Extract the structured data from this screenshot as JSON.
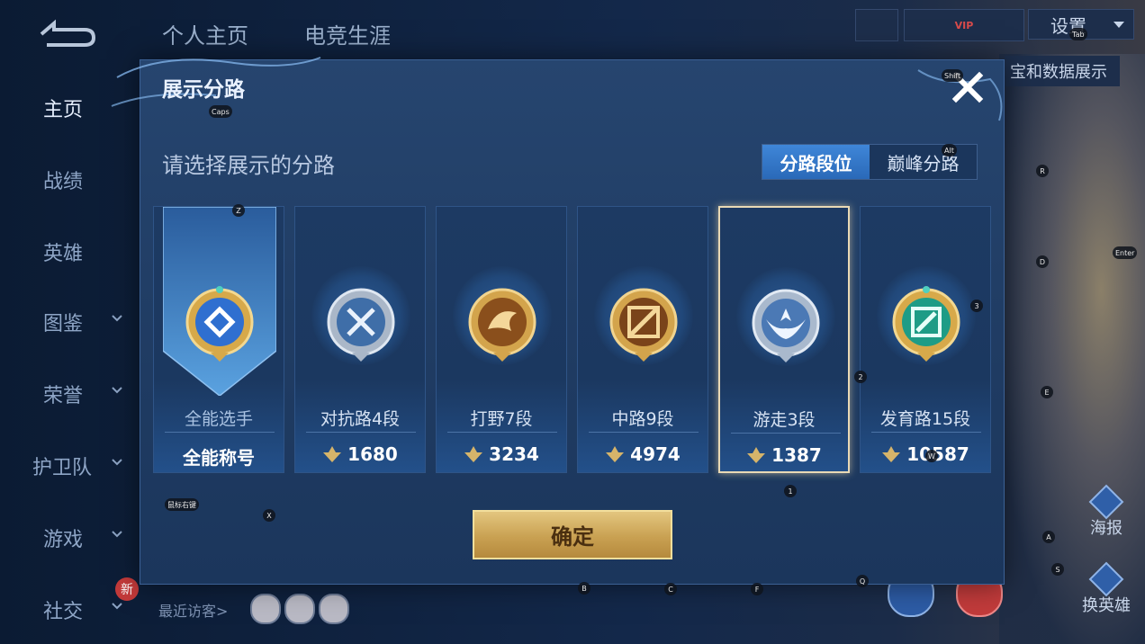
{
  "background": {
    "top_tabs": [
      "个人主页",
      "电竞生涯"
    ],
    "sidebar": [
      {
        "label": "主页",
        "has_chevron": false
      },
      {
        "label": "战绩",
        "has_chevron": false
      },
      {
        "label": "英雄",
        "has_chevron": false
      },
      {
        "label": "图鉴",
        "has_chevron": true
      },
      {
        "label": "荣誉",
        "has_chevron": true
      },
      {
        "label": "护卫队",
        "has_chevron": true
      },
      {
        "label": "游戏",
        "has_chevron": true
      },
      {
        "label": "社交",
        "has_chevron": true
      }
    ],
    "new_badge": "新",
    "recent_visitors": "最近访客>",
    "settings_label": "设置",
    "data_display_label": "宝和数据展示",
    "vip_label": "VIP",
    "right_buttons": [
      "海报",
      "换英雄"
    ]
  },
  "dialog": {
    "title": "展示分路",
    "subtitle": "请选择展示的分路",
    "toggle": [
      "分路段位",
      "巅峰分路"
    ],
    "confirm_label": "确定",
    "cards": [
      {
        "name": "全能选手",
        "bottom": "全能称号",
        "icon": "all-round-emblem-icon",
        "colors": [
          "#d7a94a",
          "#2f6fd0"
        ]
      },
      {
        "name": "对抗路4段",
        "score": "1680",
        "icon": "clash-lane-emblem-icon",
        "colors": [
          "#aab7c8",
          "#3f6ea8"
        ]
      },
      {
        "name": "打野7段",
        "score": "3234",
        "icon": "jungle-emblem-icon",
        "colors": [
          "#d3a44c",
          "#8a4f1c"
        ]
      },
      {
        "name": "中路9段",
        "score": "4974",
        "icon": "mid-lane-emblem-icon",
        "colors": [
          "#d3a44c",
          "#7a431a"
        ]
      },
      {
        "name": "游走3段",
        "score": "1387",
        "icon": "roam-emblem-icon",
        "colors": [
          "#a9b9cd",
          "#4b79b5"
        ],
        "selected": true
      },
      {
        "name": "发育路15段",
        "score": "10587",
        "icon": "farm-lane-emblem-icon",
        "colors": [
          "#d7a94a",
          "#1e9c86"
        ]
      }
    ]
  },
  "key_hints": [
    {
      "text": "Shift"
    },
    {
      "text": "Caps"
    },
    {
      "text": "Alt"
    },
    {
      "text": "R"
    },
    {
      "text": "Tab"
    },
    {
      "text": "Z"
    },
    {
      "text": "D"
    },
    {
      "text": "Enter"
    },
    {
      "text": "3"
    },
    {
      "text": "2"
    },
    {
      "text": "E"
    },
    {
      "text": "1"
    },
    {
      "text": "鼠标右键"
    },
    {
      "text": "X"
    },
    {
      "text": "A"
    },
    {
      "text": "S"
    },
    {
      "text": "B"
    },
    {
      "text": "C"
    },
    {
      "text": "F"
    },
    {
      "text": "Q"
    },
    {
      "text": "W"
    }
  ]
}
